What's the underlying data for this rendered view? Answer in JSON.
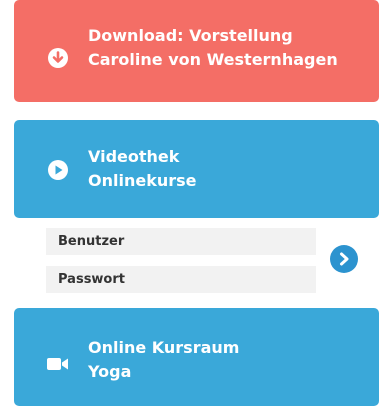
{
  "download": {
    "line1": "Download: Vorstellung",
    "line2": "Caroline von Westernhagen",
    "icon": "download-circle-icon"
  },
  "videothek": {
    "line1": "Videothek",
    "line2": "Onlinekurse",
    "icon": "play-circle-icon"
  },
  "login": {
    "username_placeholder": "Benutzer",
    "username_value": "",
    "password_placeholder": "Passwort",
    "password_value": "",
    "submit_icon": "chevron-right-circle-icon"
  },
  "kursraum": {
    "line1": "Online Kursraum",
    "line2": "Yoga",
    "icon": "video-camera-icon"
  },
  "colors": {
    "download_bg": "#f46e66",
    "panel_bg": "#3aa8d9",
    "submit_bg": "#2c93cf",
    "field_bg": "#f2f2f2"
  }
}
